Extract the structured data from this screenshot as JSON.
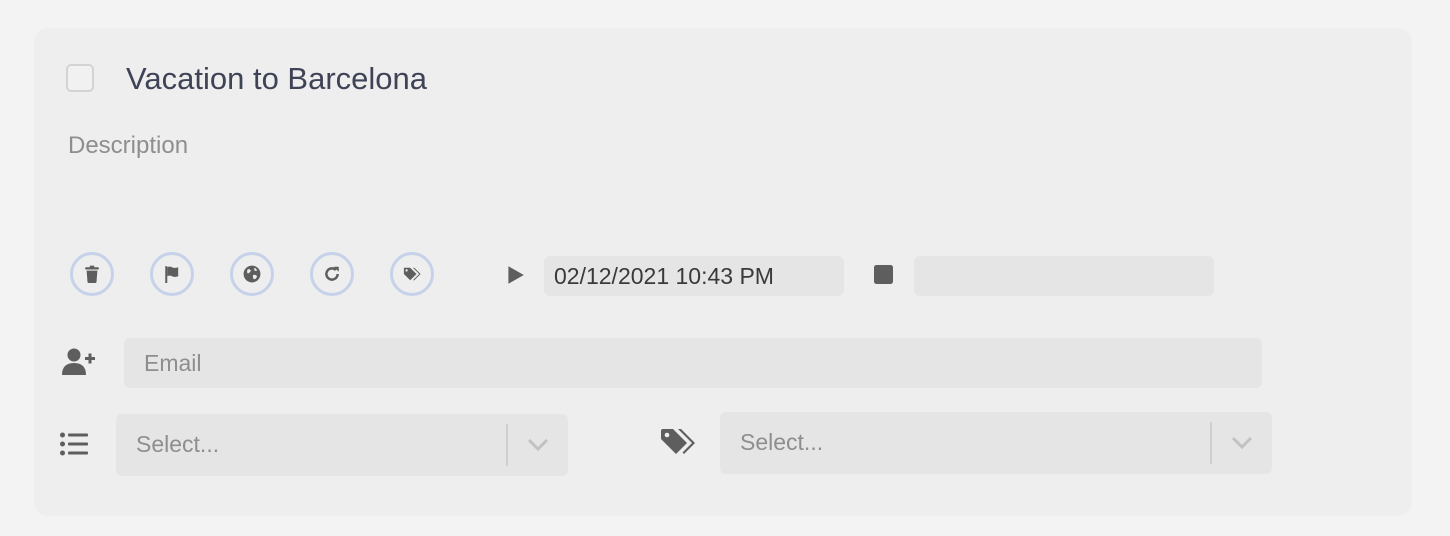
{
  "task": {
    "title": "Vacation to Barcelona",
    "description_placeholder": "Description",
    "completed": false
  },
  "actions": {
    "icons": [
      "trash-icon",
      "flag-icon",
      "globe-icon",
      "redo-icon",
      "tags-icon"
    ]
  },
  "timer": {
    "start_value": "02/12/2021 10:43 PM",
    "end_value": ""
  },
  "share": {
    "email_placeholder": "Email"
  },
  "list_select": {
    "placeholder": "Select..."
  },
  "tags_select": {
    "placeholder": "Select..."
  },
  "colors": {
    "icon": "#5e5e5e",
    "circle_border": "#c6d1ea",
    "title_text": "#3f4356"
  }
}
